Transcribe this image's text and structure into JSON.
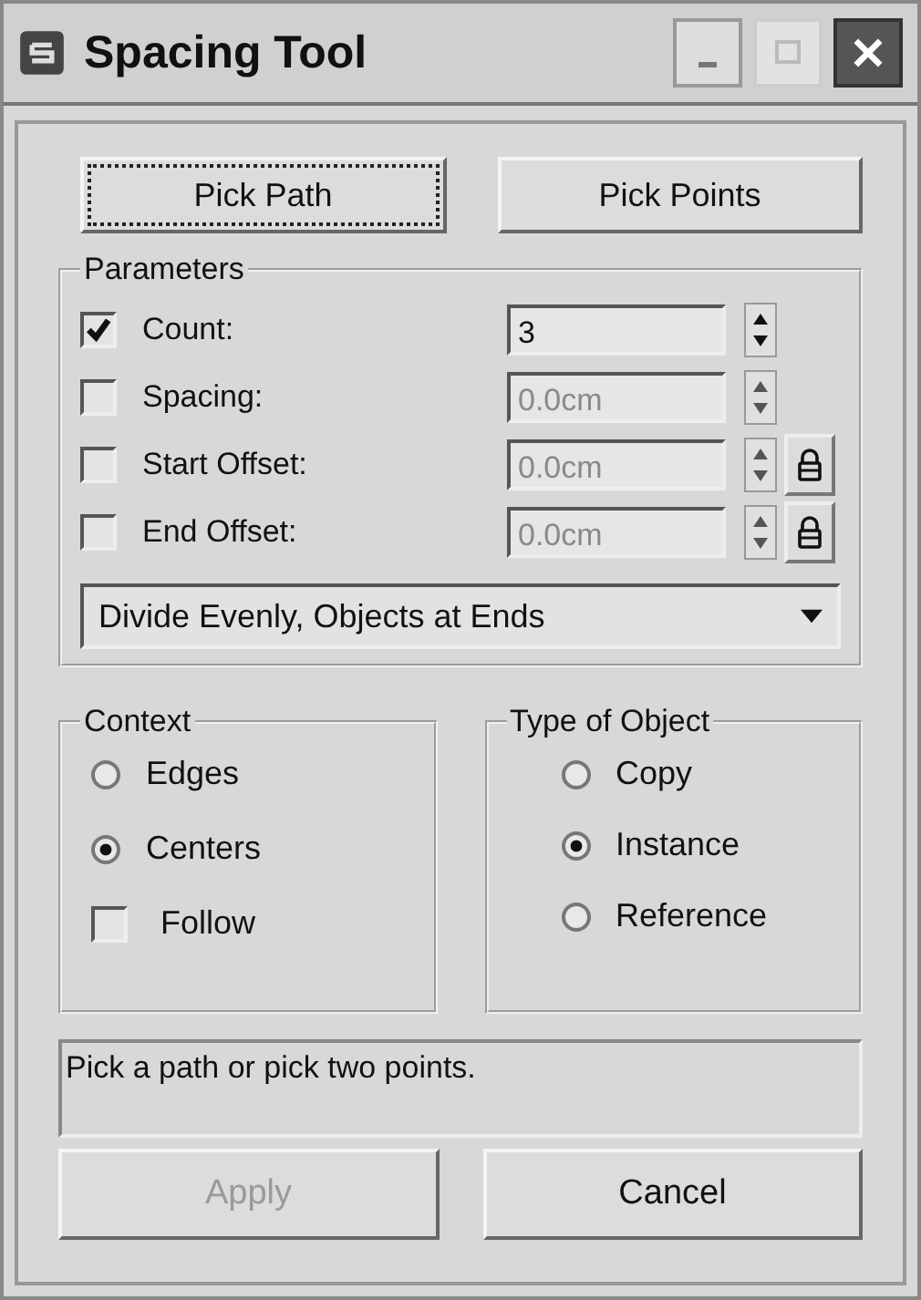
{
  "window": {
    "title": "Spacing Tool"
  },
  "pick_buttons": [
    {
      "label": "Pick Path",
      "focused": true
    },
    {
      "label": "Pick Points",
      "focused": false
    }
  ],
  "parameters": {
    "title": "Parameters",
    "rows": [
      {
        "kind": "spinner",
        "label": "Count:",
        "checked": true,
        "value": "3",
        "disabled": false
      },
      {
        "kind": "spinner",
        "label": "Spacing:",
        "checked": false,
        "value": "0.0cm",
        "disabled": true
      },
      {
        "kind": "spinner_lock",
        "label": "Start Offset:",
        "checked": false,
        "value": "0.0cm",
        "disabled": true
      },
      {
        "kind": "spinner_lock",
        "label": "End Offset:",
        "checked": false,
        "value": "0.0cm",
        "disabled": true
      }
    ],
    "dropdown": {
      "value": "Divide Evenly, Objects at Ends"
    }
  },
  "context": {
    "title": "Context",
    "items": [
      {
        "kind": "radio",
        "label": "Edges",
        "selected": false
      },
      {
        "kind": "radio",
        "label": "Centers",
        "selected": true
      },
      {
        "kind": "checkbox",
        "label": "Follow",
        "checked": false
      }
    ]
  },
  "type_of_object": {
    "title": "Type of Object",
    "items": [
      {
        "kind": "radio",
        "label": "Copy",
        "selected": false
      },
      {
        "kind": "radio",
        "label": "Instance",
        "selected": true
      },
      {
        "kind": "radio",
        "label": "Reference",
        "selected": false
      }
    ]
  },
  "status": {
    "text": "Pick a path or pick two points."
  },
  "buttons": [
    {
      "label": "Apply",
      "disabled": true
    },
    {
      "label": "Cancel",
      "disabled": false
    }
  ]
}
